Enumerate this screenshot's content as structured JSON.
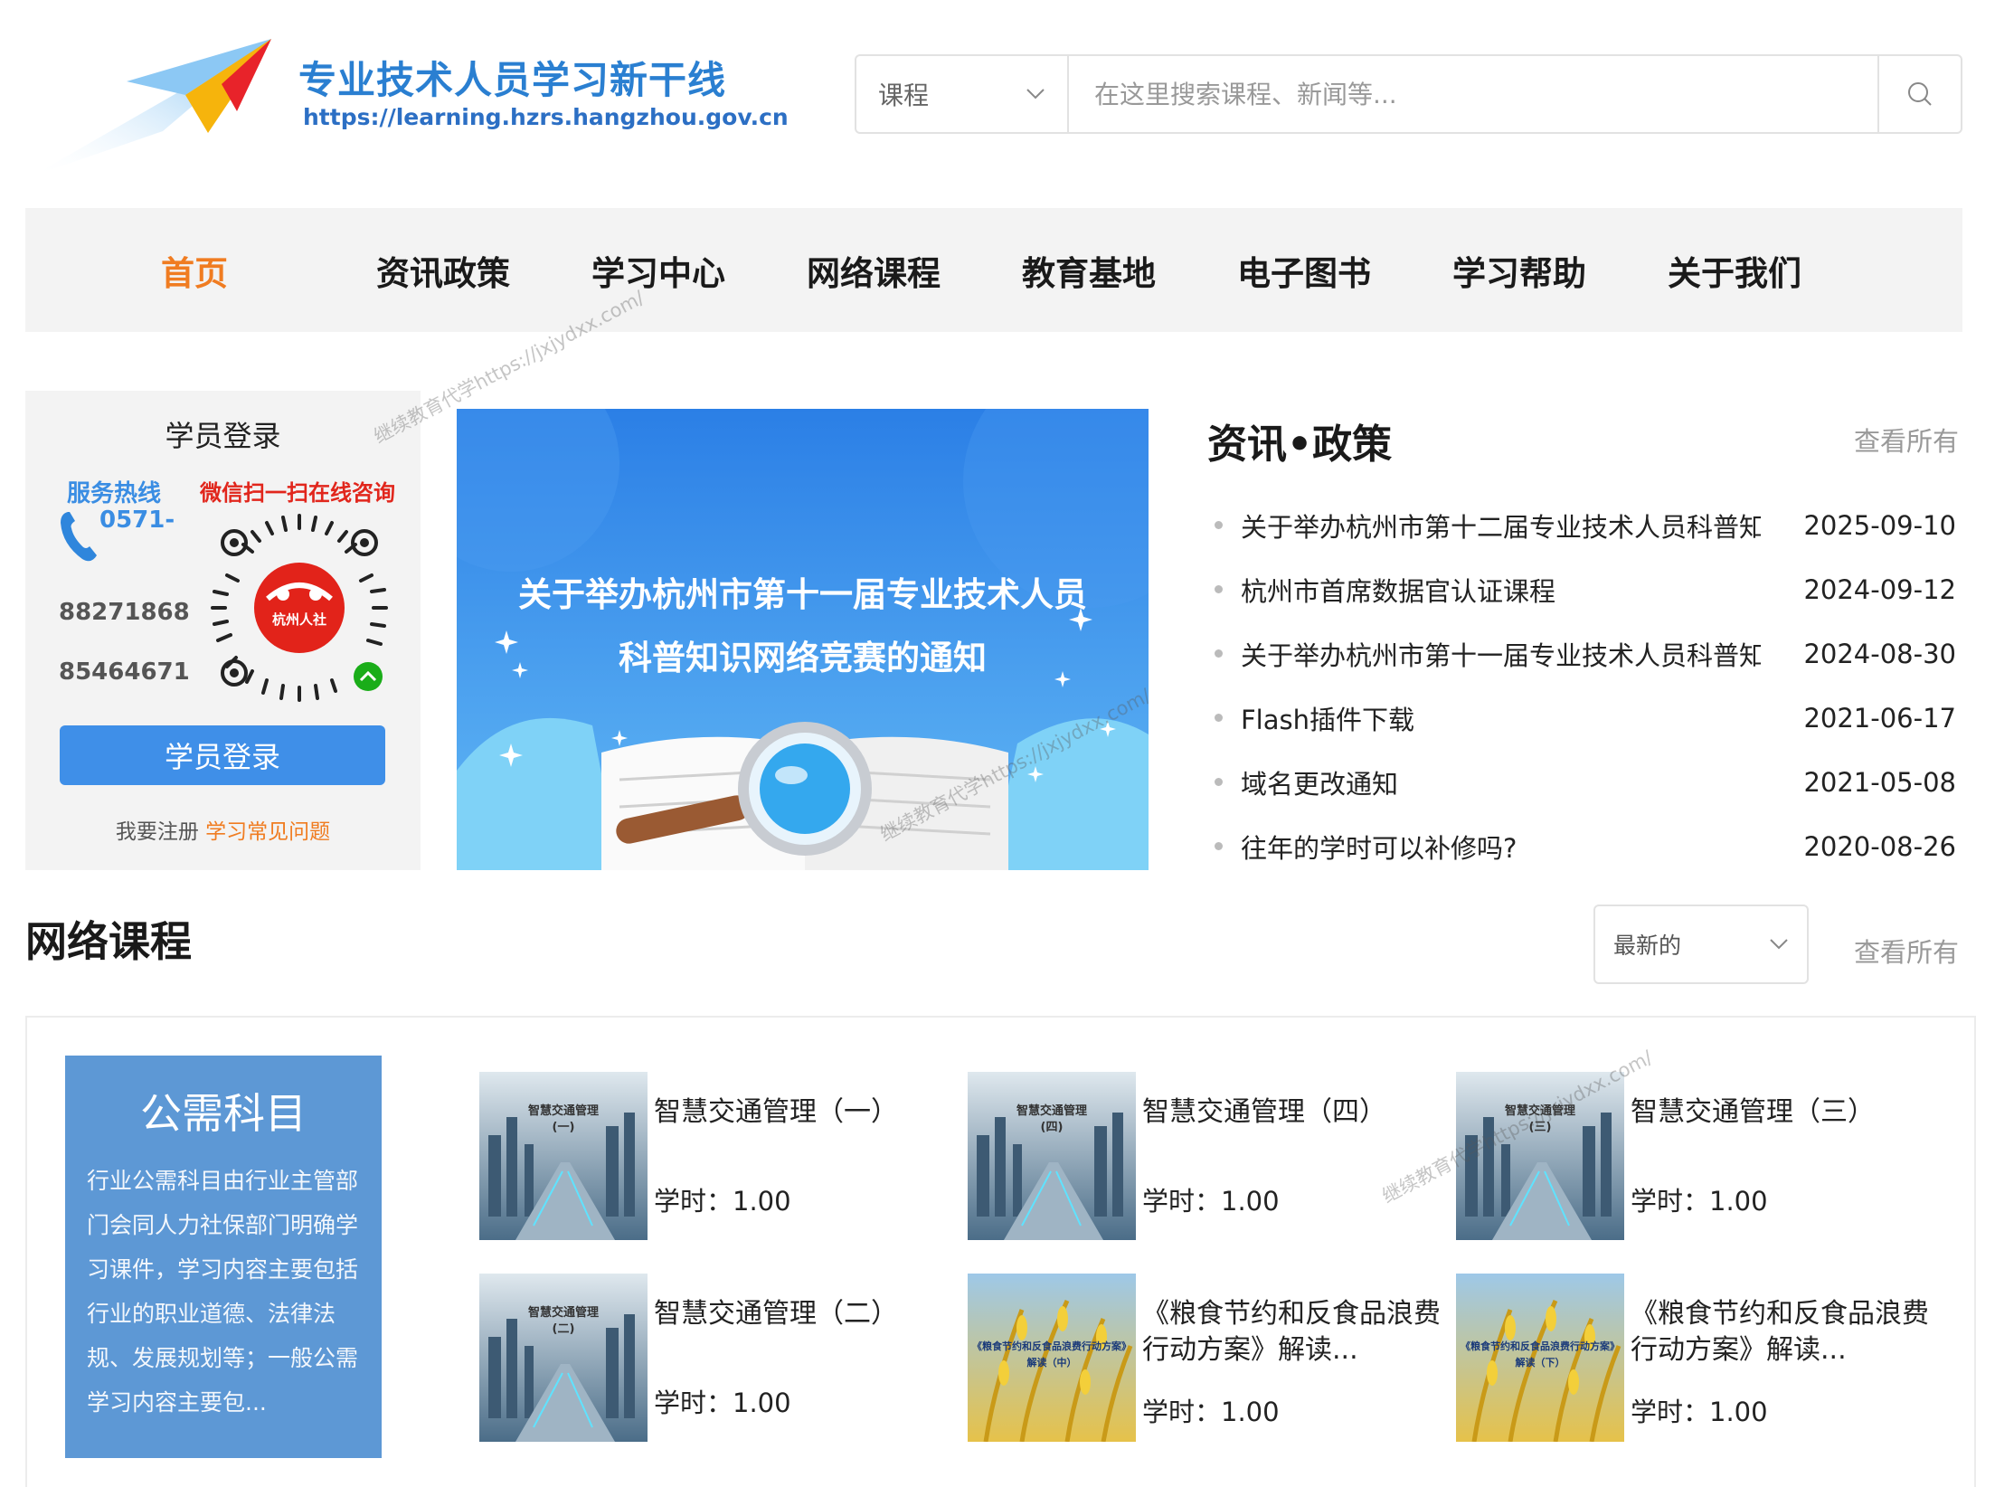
{
  "header": {
    "site_title": "专业技术人员学习新干线",
    "site_url": "https://learning.hzrs.hangzhou.gov.cn",
    "brand_color": "#2a7fd1"
  },
  "search": {
    "category": "课程",
    "placeholder": "在这里搜索课程、新闻等..."
  },
  "nav": {
    "items": [
      {
        "label": "首页",
        "active": true
      },
      {
        "label": "资讯政策"
      },
      {
        "label": "学习中心"
      },
      {
        "label": "网络课程"
      },
      {
        "label": "教育基地"
      },
      {
        "label": "电子图书"
      },
      {
        "label": "学习帮助"
      },
      {
        "label": "关于我们"
      }
    ],
    "active_color": "#f07c21"
  },
  "login": {
    "title": "学员登录",
    "hotline_label": "服务热线",
    "hotline_prefix": "0571-",
    "hotline_numbers": [
      "88271868",
      "85464671"
    ],
    "wechat_label": "微信扫一扫在线咨询",
    "qr_center_text": "杭州人社",
    "button_label": "学员登录",
    "register_link": "我要注册",
    "faq_link": "学习常见问题"
  },
  "banner": {
    "line1": "关于举办杭州市第十一届专业技术人员",
    "line2": "科普知识网络竞赛的通知"
  },
  "news": {
    "title": "资讯•政策",
    "more": "查看所有",
    "items": [
      {
        "text": "关于举办杭州市第十二届专业技术人员科普知...",
        "date": "2025-09-10"
      },
      {
        "text": "杭州市首席数据官认证课程",
        "date": "2024-09-12"
      },
      {
        "text": "关于举办杭州市第十一届专业技术人员科普知...",
        "date": "2024-08-30"
      },
      {
        "text": "Flash插件下载",
        "date": "2021-06-17"
      },
      {
        "text": "域名更改通知",
        "date": "2021-05-08"
      },
      {
        "text": "往年的学时可以补修吗?",
        "date": "2020-08-26"
      }
    ]
  },
  "courses": {
    "title": "网络课程",
    "sort_selected": "最新的",
    "more": "查看所有",
    "public_card": {
      "title": "公需科目",
      "desc": "行业公需科目由行业主管部门会同人力社保部门明确学习课件，学习内容主要包括行业的职业道德、法律法规、发展规划等；一般公需学习内容主要包..."
    },
    "items": [
      {
        "name": "智慧交通管理（一）",
        "hours": "学时：1.00",
        "thumb": "智慧交通管理\n(一)"
      },
      {
        "name": "智慧交通管理（四）",
        "hours": "学时：1.00",
        "thumb": "智慧交通管理\n(四)"
      },
      {
        "name": "智慧交通管理（三）",
        "hours": "学时：1.00",
        "thumb": "智慧交通管理\n(三)"
      },
      {
        "name": "智慧交通管理（二）",
        "hours": "学时：1.00",
        "thumb": "智慧交通管理\n(二)"
      },
      {
        "name": "《粮食节约和反食品浪费行动方案》解读...",
        "hours": "学时：1.00",
        "thumb": "《粮食节约和反食品浪费行动方案》\n解读（中）"
      },
      {
        "name": "《粮食节约和反食品浪费行动方案》解读...",
        "hours": "学时：1.00",
        "thumb": "《粮食节约和反食品浪费行动方案》\n解读（下）"
      }
    ]
  },
  "watermark": "继续教育代学https://jxjydxx.com/"
}
